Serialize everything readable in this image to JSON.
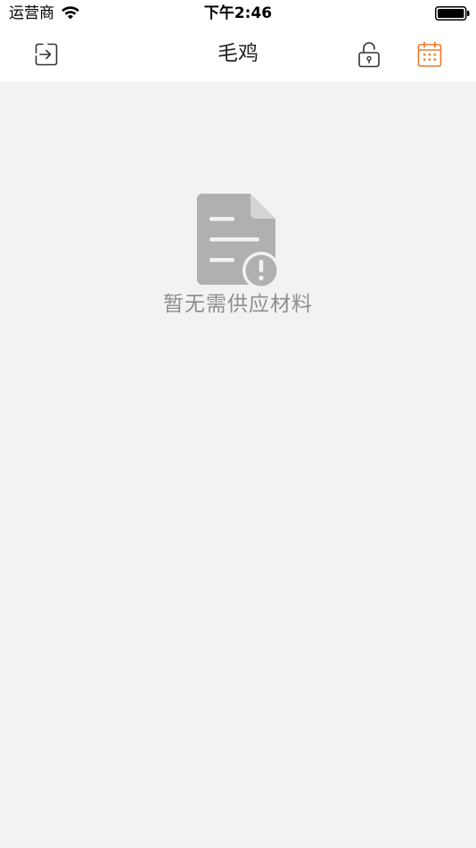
{
  "status_bar": {
    "carrier": "运营商",
    "time": "下午2:46"
  },
  "nav": {
    "title": "毛鸡",
    "left_icon": "exit-icon",
    "right_icons": [
      "lock-open-icon",
      "calendar-icon"
    ]
  },
  "empty_state": {
    "icon": "document-warning-icon",
    "message": "暂无需供应材料"
  },
  "colors": {
    "accent": "#f07a2c",
    "background": "#f2f2f2",
    "icon_gray": "#b0b0b0",
    "text_gray": "#8e8e8e"
  }
}
